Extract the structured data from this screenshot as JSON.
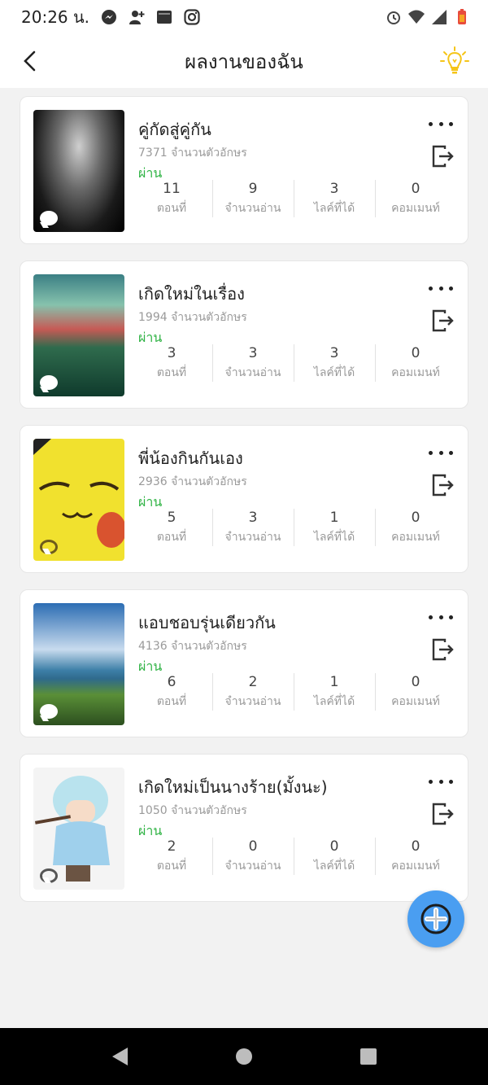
{
  "status_bar": {
    "time": "20:26 น.",
    "icons": [
      "messenger-icon",
      "add-person-icon",
      "gallery-icon",
      "instagram-icon",
      "alarm-icon",
      "wifi-icon",
      "signal-icon",
      "battery-icon"
    ]
  },
  "header": {
    "title": "ผลงานของฉัน",
    "back_icon": "chevron-left-icon",
    "hint_icon": "lightbulb-icon"
  },
  "colors": {
    "accent": "#4a9ef1",
    "status_pass": "#2fb344",
    "hint_icon": "#f5c518"
  },
  "stat_labels": [
    "ตอนที่",
    "จำนวนอ่าน",
    "ไลค์ที่ได้",
    "คอมเมนท์"
  ],
  "works": [
    {
      "title": "คู่กัดสู่คู่กัน",
      "char_count": "7371 จำนวนตัวอักษร",
      "status": "ผ่าน",
      "stats": [
        "11",
        "9",
        "3",
        "0"
      ]
    },
    {
      "title": "เกิดใหม่ในเรื่อง",
      "char_count": "1994 จำนวนตัวอักษร",
      "status": "ผ่าน",
      "stats": [
        "3",
        "3",
        "3",
        "0"
      ]
    },
    {
      "title": "พี่น้องกินกันเอง",
      "char_count": "2936 จำนวนตัวอักษร",
      "status": "ผ่าน",
      "stats": [
        "5",
        "3",
        "1",
        "0"
      ]
    },
    {
      "title": "แอบชอบรุ่นเดียวกัน",
      "char_count": "4136 จำนวนตัวอักษร",
      "status": "ผ่าน",
      "stats": [
        "6",
        "2",
        "1",
        "0"
      ]
    },
    {
      "title": "เกิดใหม่เป็นนางร้าย(มั้งนะ)",
      "char_count": "1050 จำนวนตัวอักษร",
      "status": "ผ่าน",
      "stats": [
        "2",
        "0",
        "0",
        "0"
      ]
    }
  ],
  "fab_icon": "plus-icon",
  "nav": [
    "back-triangle-icon",
    "home-circle-icon",
    "recents-square-icon"
  ]
}
